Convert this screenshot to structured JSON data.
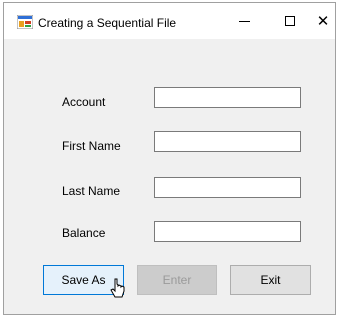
{
  "window": {
    "title": "Creating a Sequential File",
    "minimize_glyph": "",
    "maximize_glyph": "",
    "close_glyph": "✕"
  },
  "form": {
    "fields": [
      {
        "label": "Account",
        "value": ""
      },
      {
        "label": "First Name",
        "value": ""
      },
      {
        "label": "Last Name",
        "value": ""
      },
      {
        "label": "Balance",
        "value": ""
      }
    ]
  },
  "buttons": {
    "save_as": "Save As",
    "enter": "Enter",
    "exit": "Exit"
  },
  "colors": {
    "focus_border": "#0078d7",
    "disabled_bg": "#cccccc"
  }
}
